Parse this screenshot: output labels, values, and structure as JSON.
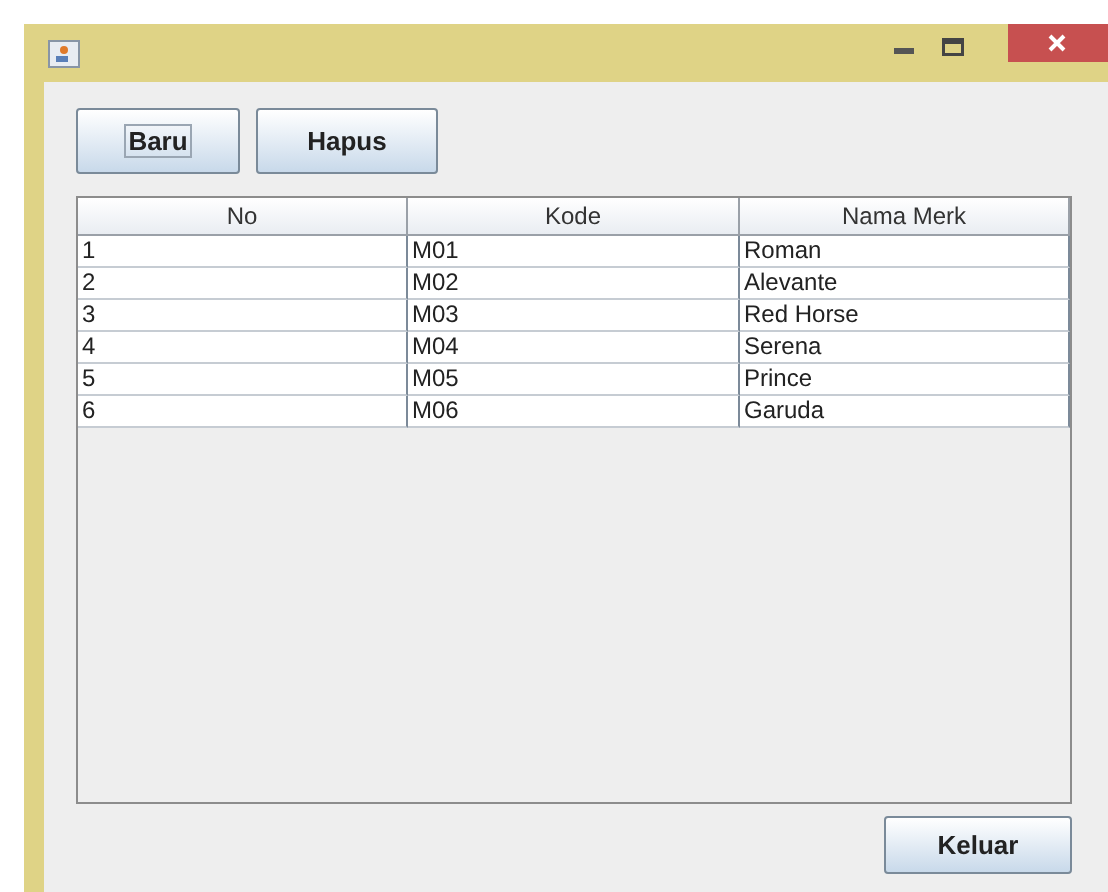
{
  "toolbar": [
    {
      "label": "Baru",
      "focused": true
    },
    {
      "label": "Hapus",
      "focused": false
    }
  ],
  "table": {
    "columns": [
      "No",
      "Kode",
      "Nama Merk"
    ],
    "rows": [
      [
        "1",
        "M01",
        "Roman"
      ],
      [
        "2",
        "M02",
        "Alevante"
      ],
      [
        "3",
        "M03",
        "Red Horse"
      ],
      [
        "4",
        "M04",
        "Serena"
      ],
      [
        "5",
        "M05",
        "Prince"
      ],
      [
        "6",
        "M06",
        "Garuda"
      ]
    ]
  },
  "footer_button": {
    "label": "Keluar",
    "focused": false
  }
}
